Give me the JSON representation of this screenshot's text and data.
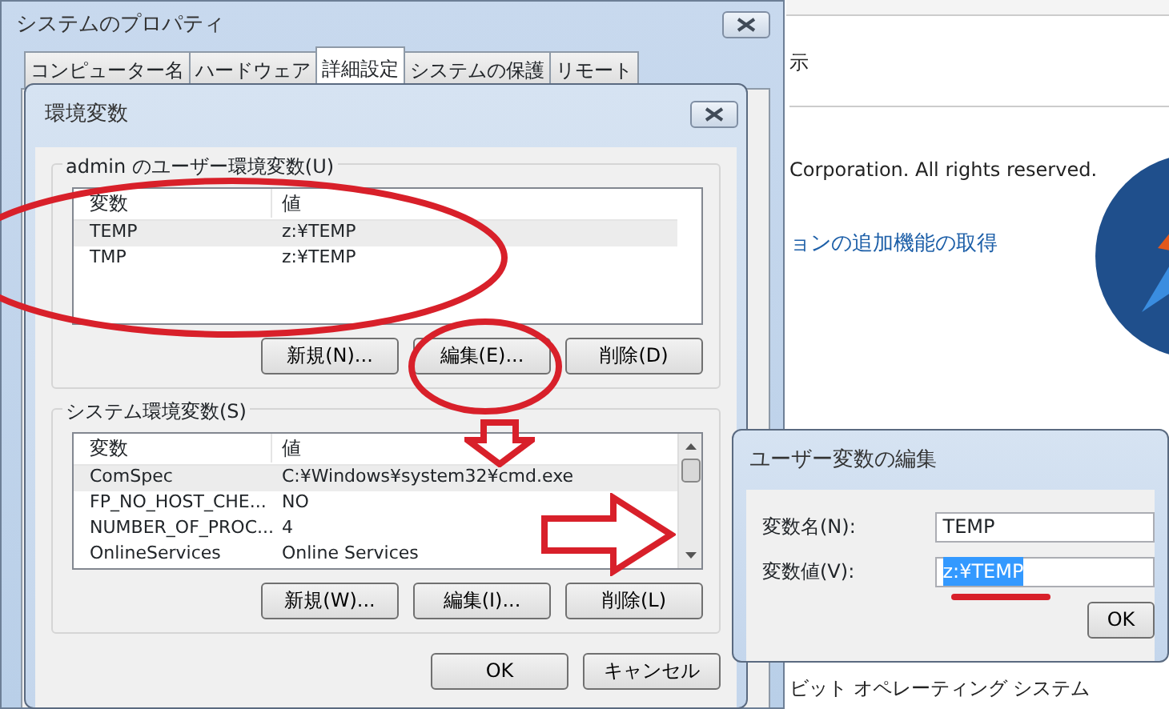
{
  "background_window": {
    "top_text": "示",
    "copyright": "Corporation.  All rights reserved.",
    "link": "ョンの追加機能の取得",
    "system_type": "ビット オペレーティング システム"
  },
  "system_properties": {
    "title": "システムのプロパティ",
    "tabs": [
      {
        "label": "コンピューター名",
        "selected": false
      },
      {
        "label": "ハードウェア",
        "selected": false
      },
      {
        "label": "詳細設定",
        "selected": true
      },
      {
        "label": "システムの保護",
        "selected": false
      },
      {
        "label": "リモート",
        "selected": false
      }
    ]
  },
  "environment_dialog": {
    "title": "環境変数",
    "user_variables": {
      "label": "admin のユーザー環境変数(U)",
      "columns": [
        "変数",
        "値"
      ],
      "rows": [
        {
          "name": "TEMP",
          "value": "z:¥TEMP",
          "selected": true
        },
        {
          "name": "TMP",
          "value": "z:¥TEMP",
          "selected": false
        }
      ],
      "buttons": [
        "新規(N)...",
        "編集(E)...",
        "削除(D)"
      ]
    },
    "system_variables": {
      "label": "システム環境変数(S)",
      "columns": [
        "変数",
        "値"
      ],
      "rows": [
        {
          "name": "ComSpec",
          "value": "C:¥Windows¥system32¥cmd.exe",
          "selected": true
        },
        {
          "name": "FP_NO_HOST_CHE...",
          "value": "NO",
          "selected": false
        },
        {
          "name": "NUMBER_OF_PROC...",
          "value": "4",
          "selected": false
        },
        {
          "name": "OnlineServices",
          "value": "Online Services",
          "selected": false
        }
      ],
      "buttons": [
        "新規(W)...",
        "編集(I)...",
        "削除(L)"
      ]
    },
    "buttons": [
      "OK",
      "キャンセル"
    ]
  },
  "edit_dialog": {
    "title": "ユーザー変数の編集",
    "fields": [
      {
        "label": "変数名(N):",
        "value": "TEMP",
        "highlighted": false
      },
      {
        "label": "変数値(V):",
        "value": "z:¥TEMP",
        "highlighted": true
      }
    ],
    "buttons": [
      "OK"
    ]
  }
}
